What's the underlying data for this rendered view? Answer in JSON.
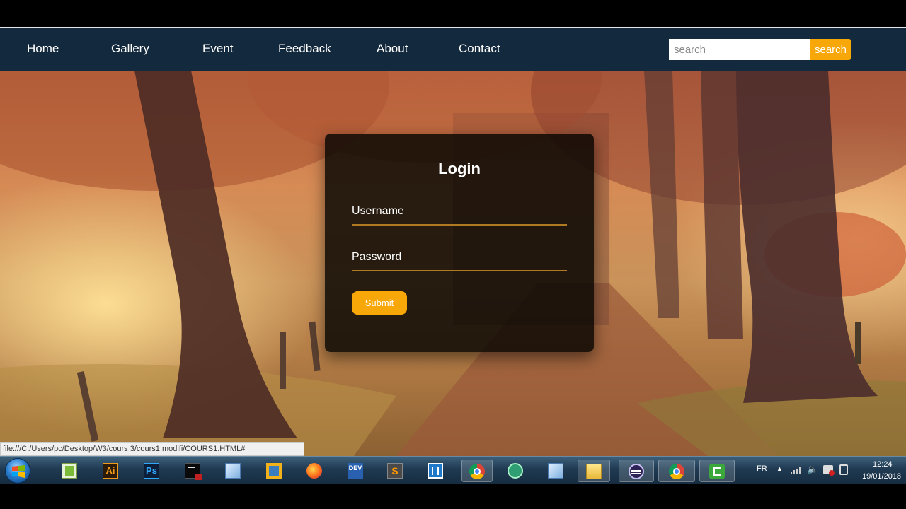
{
  "nav": {
    "items": [
      {
        "label": "Home"
      },
      {
        "label": "Gallery"
      },
      {
        "label": "Event"
      },
      {
        "label": "Feedback"
      },
      {
        "label": "About"
      },
      {
        "label": "Contact"
      }
    ],
    "search_placeholder": "search",
    "search_button": "search"
  },
  "login": {
    "title": "Login",
    "username_label": "Username",
    "password_label": "Password",
    "submit_label": "Submit"
  },
  "status_bar": {
    "url": "file:///C:/Users/pc/Desktop/W3/cours 3/cours1 modifi/COURS1.HTML#"
  },
  "taskbar": {
    "apps": [
      {
        "name": "notepad-plus-icon"
      },
      {
        "name": "illustrator-icon",
        "label": "Ai"
      },
      {
        "name": "photoshop-icon",
        "label": "Ps"
      },
      {
        "name": "terminal-icon"
      },
      {
        "name": "virtualbox-icon"
      },
      {
        "name": "vmware-icon"
      },
      {
        "name": "firefox-icon"
      },
      {
        "name": "devcpp-icon",
        "label": "DEV"
      },
      {
        "name": "sublime-icon",
        "label": "S"
      },
      {
        "name": "brackets-icon"
      },
      {
        "name": "chrome-icon"
      },
      {
        "name": "atom-icon"
      },
      {
        "name": "virtualbox-icon"
      },
      {
        "name": "file-explorer-icon"
      },
      {
        "name": "eclipse-icon"
      },
      {
        "name": "chrome-icon"
      },
      {
        "name": "camtasia-icon"
      }
    ],
    "language": "FR",
    "time": "12:24",
    "date": "19/01/2018"
  },
  "colors": {
    "navbar": "#13293d",
    "accent": "#f7a707",
    "card": "#0c0804"
  }
}
